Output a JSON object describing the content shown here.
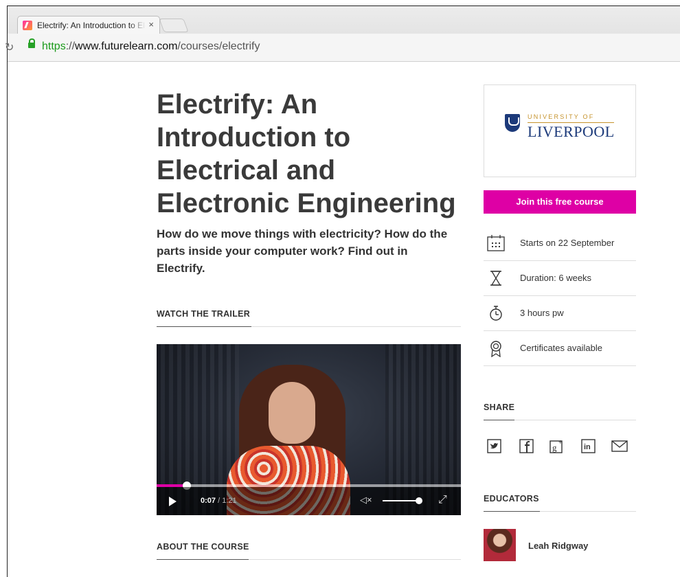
{
  "browser": {
    "tab_title": "Electrify: An Introduction to Electrical and Electronic Engineering",
    "url_scheme": "https",
    "url_sep": "://",
    "url_host": "www.futurelearn.com",
    "url_path": "/courses/electrify"
  },
  "course": {
    "title": "Electrify: An Introduction to Electrical and Electronic Engineering",
    "subtitle": "How do we move things with electricity? How do the parts inside your computer work? Find out in Electrify.",
    "watch_trailer": "WATCH THE TRAILER",
    "about": "ABOUT THE COURSE"
  },
  "video": {
    "current_time": "0:07",
    "separator": "/",
    "duration": "1:21",
    "progress": 0.1,
    "volume": 1.0
  },
  "sidebar": {
    "university_small": "UNIVERSITY OF",
    "university_big": "LIVERPOOL",
    "join_label": "Join this free course",
    "info": [
      {
        "icon": "calendar-icon",
        "text": "Starts on 22 September"
      },
      {
        "icon": "hourglass-icon",
        "text": "Duration: 6 weeks"
      },
      {
        "icon": "stopwatch-icon",
        "text": "3 hours pw"
      },
      {
        "icon": "certificate-icon",
        "text": "Certificates available"
      }
    ],
    "share_heading": "SHARE",
    "share_icons": [
      "twitter-icon",
      "facebook-icon",
      "googleplus-icon",
      "linkedin-icon",
      "email-icon"
    ],
    "educators_heading": "EDUCATORS",
    "educator_name": "Leah Ridgway"
  },
  "colors": {
    "accent": "#de00a5",
    "university_blue": "#1c3a7a",
    "university_gold": "#c5922b",
    "secure_green": "#1a9a1a"
  }
}
